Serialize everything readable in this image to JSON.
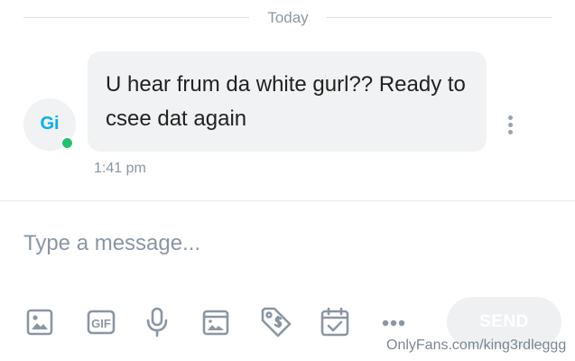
{
  "date_divider": {
    "label": "Today"
  },
  "sender": {
    "initials": "Gi"
  },
  "message": {
    "text": "U hear frum da white gurl?? Ready to csee dat again",
    "time": "1:41 pm"
  },
  "composer": {
    "placeholder": "Type a message...",
    "send_label": "SEND",
    "tools": [
      "image-icon",
      "gif-icon",
      "microphone-icon",
      "vault-media-icon",
      "price-tag-icon",
      "calendar-icon",
      "more-options-icon"
    ]
  },
  "colors": {
    "accent": "#00aff0",
    "online": "#25c16f",
    "icon": "#8a96a3",
    "bubble": "#f1f2f3"
  },
  "watermark": "OnlyFans.com/king3rdleggg"
}
